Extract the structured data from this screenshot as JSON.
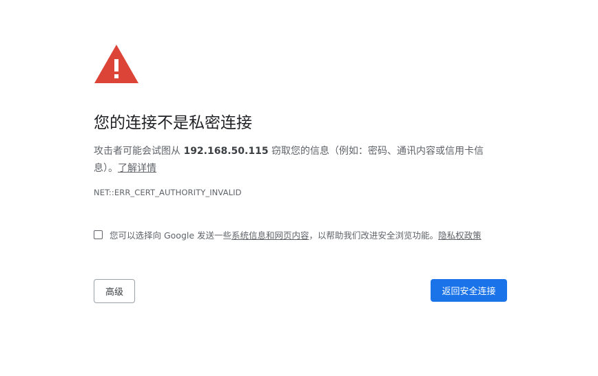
{
  "icons": {
    "warning": "warning-triangle-icon"
  },
  "colors": {
    "warning_red": "#db4437",
    "primary_blue": "#1a73e8",
    "title_text": "#202124",
    "body_text": "#5f6368"
  },
  "heading": {
    "title": "您的连接不是私密连接"
  },
  "description": {
    "prefix": "攻击者可能会试图从 ",
    "host": "192.168.50.115",
    "suffix": " 窃取您的信息（例如：密码、通讯内容或信用卡信息）。",
    "learn_more": "了解详情"
  },
  "error": {
    "code": "NET::ERR_CERT_AUTHORITY_INVALID"
  },
  "optin": {
    "checked": false,
    "text_before": "您可以选择向 Google 发送一些",
    "link_system_info": "系统信息和网页内容",
    "text_middle": "，以帮助我们改进安全浏览功能。",
    "link_privacy": "隐私权政策"
  },
  "buttons": {
    "advanced": "高级",
    "back_to_safety": "返回安全连接"
  }
}
